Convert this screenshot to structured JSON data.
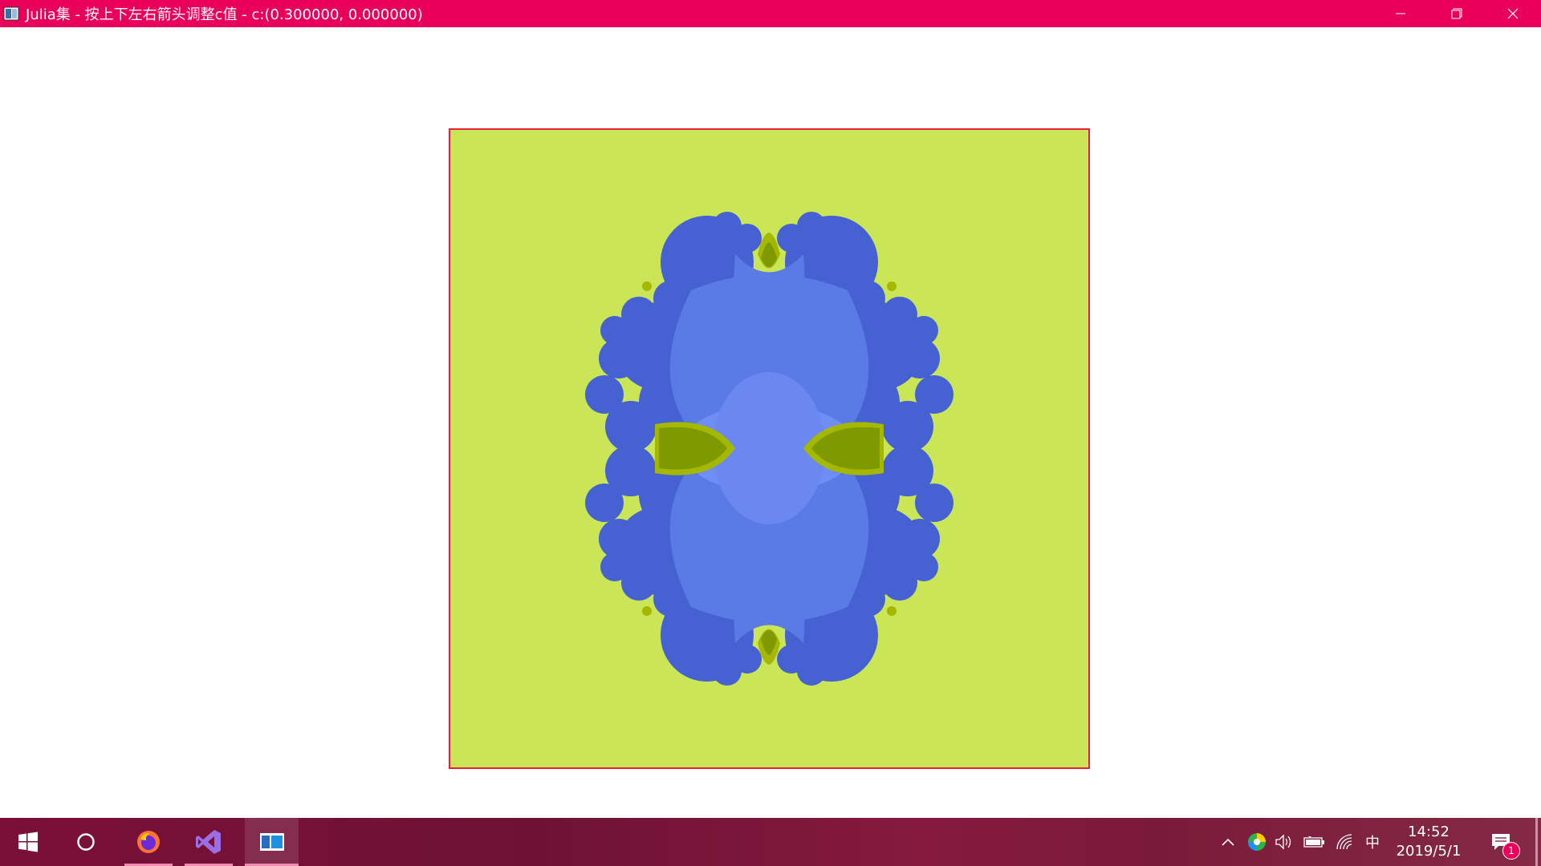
{
  "window": {
    "title": "Julia集 - 按上下左右箭头调整c值 - c:(0.300000, 0.000000)",
    "accent_color": "#e8005a",
    "canvas_background": "#cae656",
    "canvas_border_color": "#e8203a",
    "fractal_colors": [
      "#4561d2",
      "#5a7ae6",
      "#6e8ef4",
      "#7f9a00",
      "#a4b800"
    ],
    "controls": [
      "minimize-icon",
      "restore-icon",
      "close-icon"
    ]
  },
  "taskbar": {
    "apps": [
      {
        "name": "start-icon"
      },
      {
        "name": "cortana-icon"
      },
      {
        "name": "firefox-icon"
      },
      {
        "name": "visual-studio-icon"
      },
      {
        "name": "julia-app-icon",
        "active": true
      }
    ],
    "tray": {
      "ime": "中",
      "time": "14:52",
      "date": "2019/5/1",
      "notification_count": "1"
    }
  }
}
